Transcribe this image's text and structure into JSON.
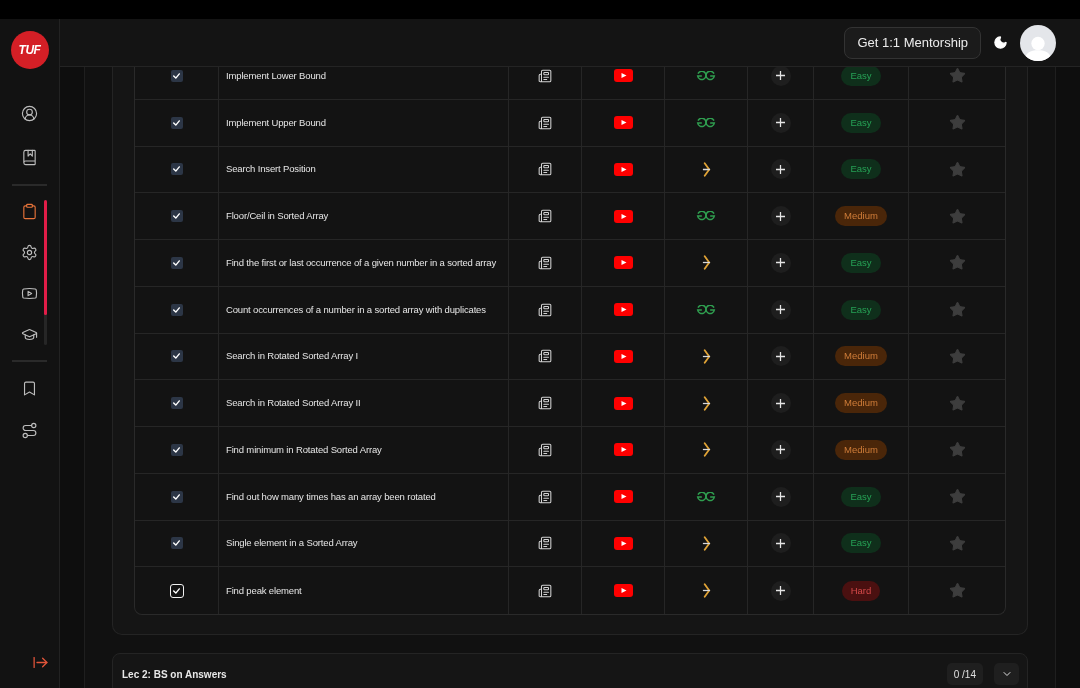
{
  "sidebar": {
    "logo": "TUF",
    "groups": [
      {
        "items": [
          {
            "kind": "profile",
            "selected": false
          },
          {
            "kind": "notebook",
            "selected": false
          }
        ]
      },
      {
        "items": [
          {
            "kind": "clipboard",
            "selected": true
          },
          {
            "kind": "gear",
            "selected": false
          },
          {
            "kind": "video",
            "selected": false
          },
          {
            "kind": "course",
            "selected": false
          }
        ]
      },
      {
        "items": [
          {
            "kind": "bookmark",
            "selected": false
          },
          {
            "kind": "route",
            "selected": false
          }
        ]
      }
    ],
    "footer": {
      "kind": "logout"
    }
  },
  "header": {
    "mentorship_button": "Get 1:1 Mentorship",
    "dark_mode": true
  },
  "table": {
    "rows": [
      {
        "checked": true,
        "focused": false,
        "problem": "Implement Lower Bound",
        "practice": {
          "kind": "gg"
        },
        "difficulty": {
          "label": "Easy",
          "color": "#0f2f1b"
        },
        "starred": false
      },
      {
        "checked": true,
        "focused": false,
        "problem": "Implement Upper Bound",
        "practice": {
          "kind": "gg"
        },
        "difficulty": {
          "label": "Easy",
          "color": "#0f2f1b"
        },
        "starred": false
      },
      {
        "checked": true,
        "focused": false,
        "problem": "Search Insert Position",
        "practice": {
          "kind": "chevron"
        },
        "difficulty": {
          "label": "Easy",
          "color": "#0f2f1b"
        },
        "starred": false
      },
      {
        "checked": true,
        "focused": false,
        "problem": "Floor/Ceil in Sorted Array",
        "practice": {
          "kind": "gg"
        },
        "difficulty": {
          "label": "Medium",
          "color": "#4a2609"
        },
        "starred": false
      },
      {
        "checked": true,
        "focused": false,
        "problem": "Find the first or last occurrence of a given number in a sorted array",
        "practice": {
          "kind": "chevron"
        },
        "difficulty": {
          "label": "Easy",
          "color": "#0f2f1b"
        },
        "starred": false
      },
      {
        "checked": true,
        "focused": false,
        "problem": "Count occurrences of a number in a sorted array with duplicates",
        "practice": {
          "kind": "gg"
        },
        "difficulty": {
          "label": "Easy",
          "color": "#0f2f1b"
        },
        "starred": false
      },
      {
        "checked": true,
        "focused": false,
        "problem": "Search in Rotated Sorted Array I",
        "practice": {
          "kind": "chevron"
        },
        "difficulty": {
          "label": "Medium",
          "color": "#4a2609"
        },
        "starred": false
      },
      {
        "checked": true,
        "focused": false,
        "problem": "Search in Rotated Sorted Array II",
        "practice": {
          "kind": "chevron"
        },
        "difficulty": {
          "label": "Medium",
          "color": "#4a2609"
        },
        "starred": false
      },
      {
        "checked": true,
        "focused": false,
        "problem": "Find minimum in Rotated Sorted Array",
        "practice": {
          "kind": "chevron"
        },
        "difficulty": {
          "label": "Medium",
          "color": "#4a2609"
        },
        "starred": false
      },
      {
        "checked": true,
        "focused": false,
        "problem": "Find out how many times has an array been rotated",
        "practice": {
          "kind": "gg"
        },
        "difficulty": {
          "label": "Easy",
          "color": "#0f2f1b"
        },
        "starred": false
      },
      {
        "checked": true,
        "focused": false,
        "problem": "Single element in a Sorted Array",
        "practice": {
          "kind": "chevron"
        },
        "difficulty": {
          "label": "Easy",
          "color": "#0f2f1b"
        },
        "starred": false
      },
      {
        "checked": true,
        "focused": true,
        "problem": "Find peak element",
        "practice": {
          "kind": "chevron"
        },
        "difficulty": {
          "label": "Hard",
          "color": "#4a1010"
        },
        "starred": false
      }
    ]
  },
  "sections": [
    {
      "title": "Lec 2: BS on Answers",
      "progress": "0 /14",
      "expanded": false
    }
  ]
}
